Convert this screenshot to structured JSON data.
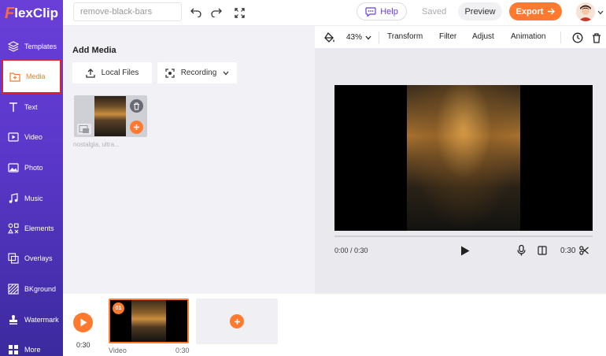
{
  "app": {
    "logo_first": "F",
    "logo_rest": "lexClip"
  },
  "sidebar": {
    "items": [
      {
        "label": "Templates",
        "icon": "templates-icon"
      },
      {
        "label": "Media",
        "icon": "media-folder-icon",
        "active": true
      },
      {
        "label": "Text",
        "icon": "text-icon"
      },
      {
        "label": "Video",
        "icon": "video-icon"
      },
      {
        "label": "Photo",
        "icon": "photo-icon"
      },
      {
        "label": "Music",
        "icon": "music-icon"
      },
      {
        "label": "Elements",
        "icon": "elements-icon"
      },
      {
        "label": "Overlays",
        "icon": "overlays-icon"
      },
      {
        "label": "BKground",
        "icon": "background-icon"
      },
      {
        "label": "Watermark",
        "icon": "watermark-icon"
      },
      {
        "label": "More",
        "icon": "more-icon"
      }
    ]
  },
  "topbar": {
    "project_name": "remove-black-bars",
    "help_label": "Help",
    "saved_label": "Saved",
    "preview_label": "Preview",
    "export_label": "Export"
  },
  "media_panel": {
    "title": "Add Media",
    "local_files_label": "Local Files",
    "recording_label": "Recording",
    "item_name": "nostalgia, ultra..."
  },
  "editor_toolbar": {
    "zoom": "43%",
    "transform_label": "Transform",
    "filter_label": "Filter",
    "adjust_label": "Adjust",
    "animation_label": "Animation"
  },
  "player": {
    "current_time": "0:00 / 0:30",
    "duration": "0:30"
  },
  "timeline": {
    "total_time": "0:30",
    "clip_number": "01",
    "clip_label": "Video",
    "clip_duration": "0:30"
  },
  "colors": {
    "accent": "#ff7a2f",
    "sidebar": "#5a37c9",
    "highlight_border": "#d9232e"
  }
}
